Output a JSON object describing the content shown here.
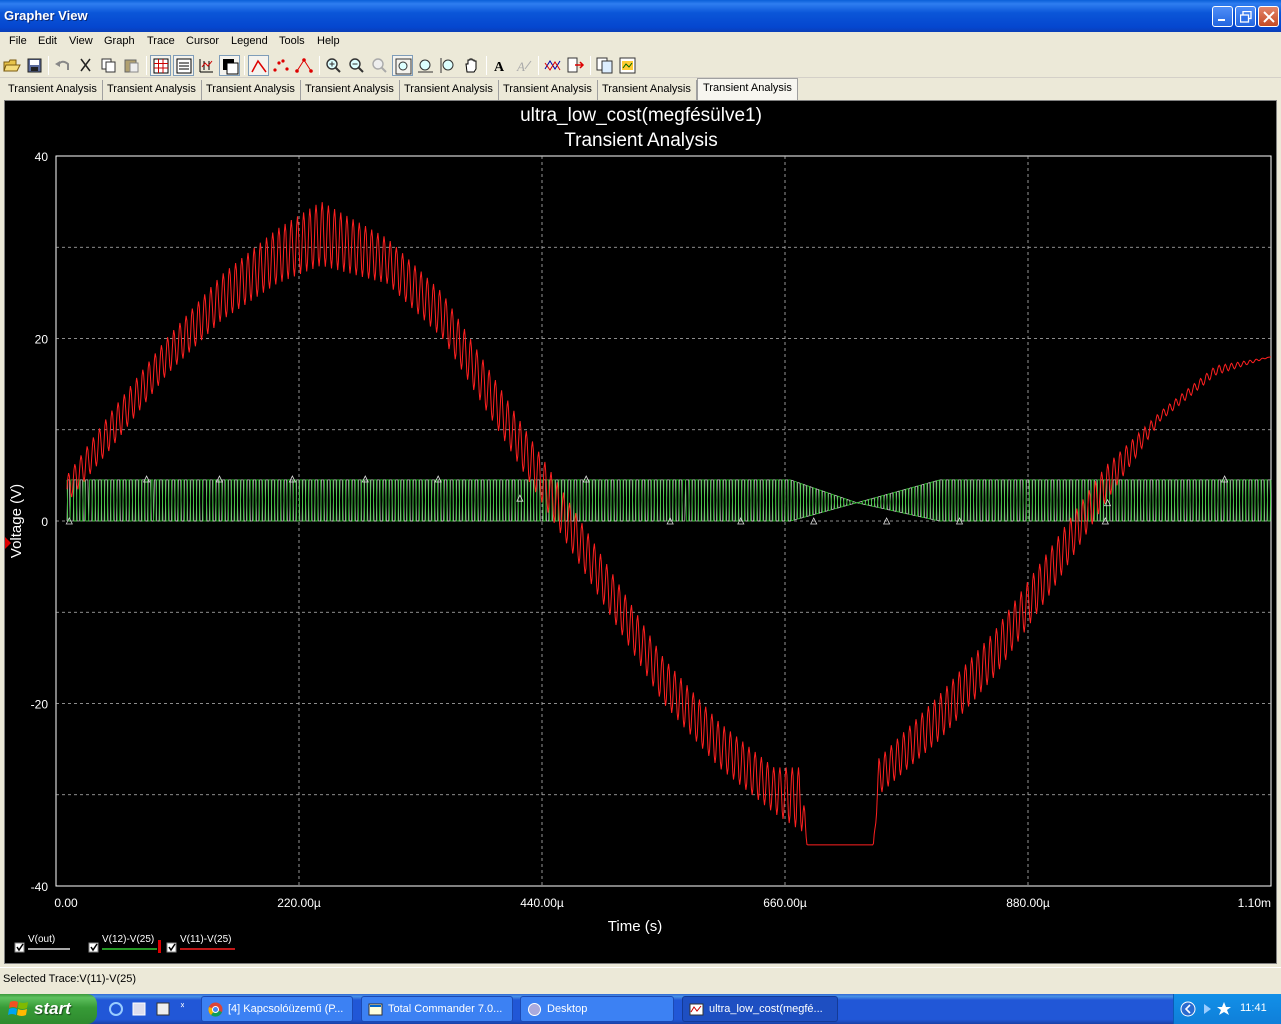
{
  "window": {
    "title": "Grapher View"
  },
  "menu": [
    "File",
    "Edit",
    "View",
    "Graph",
    "Trace",
    "Cursor",
    "Legend",
    "Tools",
    "Help"
  ],
  "toolbar": {
    "icons": [
      "open-icon",
      "save-icon",
      "undo-icon",
      "cut-icon",
      "copy-icon",
      "paste-icon",
      "grid-icon",
      "legend-icon",
      "cursors-icon",
      "reverse-colors-icon",
      "trace-line-icon",
      "trace-points-icon",
      "trace-line-points-icon",
      "zoom-in-icon",
      "zoom-out-icon",
      "zoom-full-icon",
      "zoom-area-icon",
      "zoom-x-icon",
      "zoom-y-icon",
      "pan-icon",
      "text-icon",
      "text-disabled-icon",
      "overlay-icon",
      "export-icon",
      "copy-graph-icon",
      "properties-icon"
    ]
  },
  "tabs": [
    "Transient Analysis",
    "Transient Analysis",
    "Transient Analysis",
    "Transient Analysis",
    "Transient Analysis",
    "Transient Analysis",
    "Transient Analysis",
    "Transient Analysis"
  ],
  "graph": {
    "title_line1": "ultra_low_cost(megfésülve1)",
    "title_line2": "Transient Analysis"
  },
  "chart_data": {
    "type": "line",
    "title": "ultra_low_cost(megfésülve1)",
    "subtitle": "Transient Analysis",
    "xlabel": "Time (s)",
    "ylabel": "Voltage (V)",
    "xlim": [
      0,
      0.0011
    ],
    "ylim": [
      -40,
      40
    ],
    "x_tick_labels": [
      "0.00",
      "220.00µ",
      "440.00µ",
      "660.00µ",
      "880.00µ",
      "1.10m"
    ],
    "y_tick_labels": [
      "40",
      "20",
      "0",
      "-20",
      "-40"
    ],
    "grid": true,
    "legend_position": "bottom-left",
    "background": "#000000",
    "series": [
      {
        "name": "V(out)",
        "color": "#e0e0e0",
        "x": [
          1e-05,
          0.0001,
          0.0002,
          0.0003,
          0.0004,
          0.0005,
          0.0006,
          0.000665,
          0.000725,
          0.0008,
          0.0009,
          0.001,
          0.0011
        ],
        "low": [
          0,
          0,
          0,
          0,
          0,
          0,
          0,
          0,
          2,
          0,
          0,
          0,
          0
        ],
        "high": [
          4.5,
          4.5,
          4.5,
          4.5,
          4.5,
          4.5,
          4.5,
          4.5,
          2,
          4.5,
          4.5,
          4.5,
          4.5
        ]
      },
      {
        "name": "V(12)-V(25)",
        "color": "#33cc33",
        "x": [
          1e-05,
          0.0001,
          0.0002,
          0.0003,
          0.0004,
          0.0005,
          0.0006,
          0.000665,
          0.000725,
          0.0008,
          0.0009,
          0.001,
          0.0011
        ],
        "low": [
          0,
          0,
          0,
          0,
          0,
          0,
          0,
          0,
          2,
          0,
          0,
          0,
          0
        ],
        "high": [
          4.5,
          4.5,
          4.5,
          4.5,
          4.5,
          4.5,
          4.5,
          4.5,
          2,
          4.5,
          4.5,
          4.5,
          4.5
        ]
      },
      {
        "name": "V(11)-V(25)",
        "color": "#ff2020",
        "x": [
          1e-05,
          5e-05,
          0.0001,
          0.00015,
          0.0002,
          0.00024,
          0.0003,
          0.00035,
          0.0004,
          0.00045,
          0.0005,
          0.00055,
          0.0006,
          0.00065,
          0.000675,
          0.00068,
          0.0007,
          0.00074,
          0.000745,
          0.0008,
          0.00085,
          0.0009,
          0.00095,
          0.001,
          0.00105,
          0.0011
        ],
        "low": [
          2,
          8,
          16,
          22,
          26,
          28,
          26,
          20,
          10,
          0,
          -10,
          -20,
          -27,
          -32,
          -34,
          -35.5,
          -35.5,
          -35.5,
          -30,
          -24,
          -17,
          -8,
          2,
          11,
          16,
          18
        ],
        "high": [
          5,
          12,
          20,
          27,
          32,
          35,
          31,
          25,
          15,
          5,
          -5,
          -15,
          -22,
          -27,
          -27,
          -35.5,
          -35.5,
          -35.5,
          -26,
          -19,
          -12,
          -3,
          6,
          12,
          17,
          18
        ]
      }
    ]
  },
  "legend": {
    "items": [
      {
        "label": "V(out)",
        "color": "#e0e0e0",
        "checked": true
      },
      {
        "label": "V(12)-V(25)",
        "color": "#33cc33",
        "checked": true
      },
      {
        "label": "V(11)-V(25)",
        "color": "#ff2020",
        "checked": true
      }
    ]
  },
  "status": {
    "text": "Selected Trace:V(11)-V(25)"
  },
  "taskbar": {
    "start_label": "start",
    "tasks": [
      {
        "label": "[4] Kapcsolóüzemű (P...",
        "icon": "chrome-icon"
      },
      {
        "label": "Total Commander 7.0...",
        "icon": "total-commander-icon"
      },
      {
        "label": "Desktop",
        "icon": "desktop-icon"
      },
      {
        "label": "ultra_low_cost(megfé...",
        "icon": "grapher-icon"
      }
    ],
    "clock": "11:41"
  }
}
